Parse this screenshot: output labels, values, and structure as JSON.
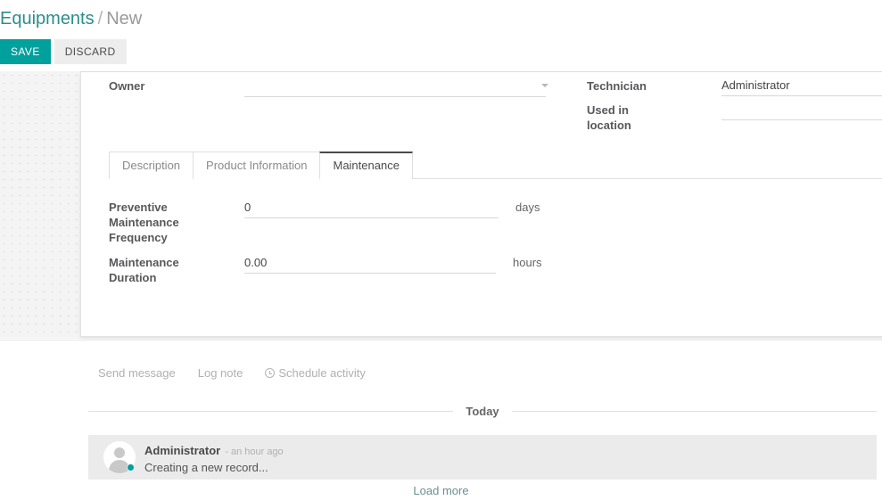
{
  "breadcrumb": {
    "parent": "Equipments",
    "separator": "/",
    "current": "New"
  },
  "toolbar": {
    "save_label": "SAVE",
    "discard_label": "DISCARD",
    "save_color": "#00a09d",
    "discard_color": "#ededed"
  },
  "form": {
    "left_fields": [
      {
        "label": "Owner",
        "value": "",
        "has_dropdown": true
      }
    ],
    "right_fields": [
      {
        "label": "Technician",
        "value": "Administrator"
      },
      {
        "label": "Used in location",
        "value": ""
      }
    ]
  },
  "notebook": {
    "tabs": [
      {
        "label": "Description",
        "active": false
      },
      {
        "label": "Product Information",
        "active": false
      },
      {
        "label": "Maintenance",
        "active": true
      }
    ],
    "maintenance_fields": [
      {
        "label": "Preventive Maintenance Frequency",
        "value": "0",
        "suffix": "days"
      },
      {
        "label": "Maintenance Duration",
        "value": "0.00",
        "suffix": "hours"
      }
    ]
  },
  "chatter": {
    "composer": {
      "send_message": "Send message",
      "log_note": "Log note",
      "schedule_activity": "Schedule activity",
      "schedule_icon": "clock-icon"
    },
    "day_divider": "Today",
    "messages": [
      {
        "author": "Administrator",
        "time": "- an hour ago",
        "text": "Creating a new record...",
        "status_color": "#00a09d"
      }
    ],
    "load_more": "Load more"
  },
  "colors": {
    "accent": "#00a09d",
    "breadcrumb_link": "#2b8c8c",
    "sheet_bg": "#ffffff",
    "page_bg": "#f4f4f4"
  }
}
